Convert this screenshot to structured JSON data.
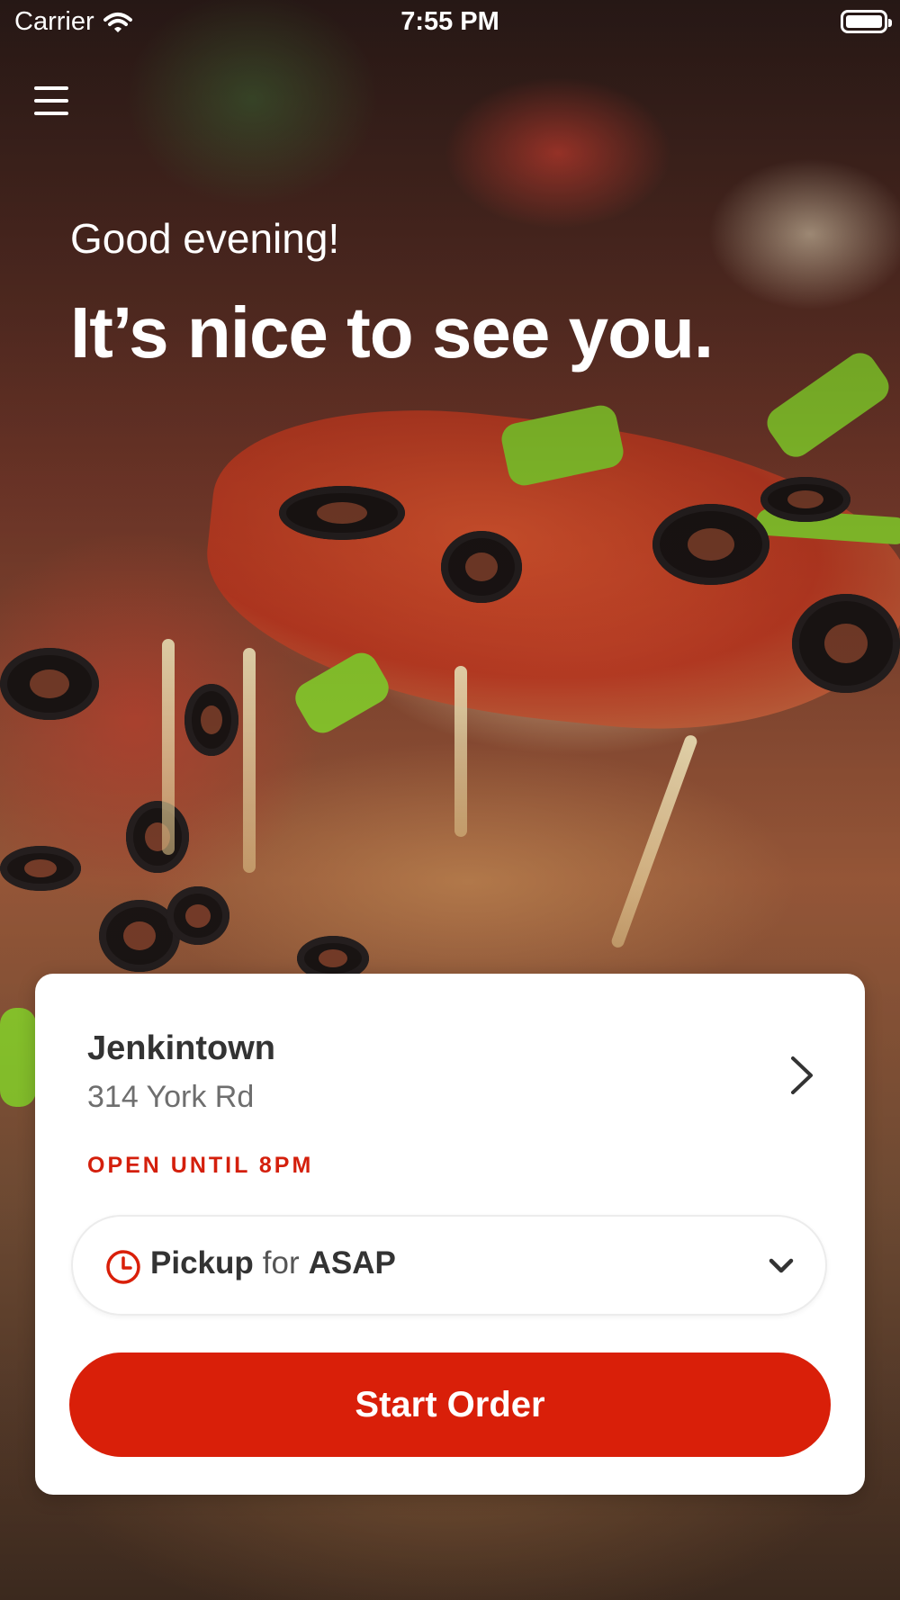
{
  "status_bar": {
    "carrier": "Carrier",
    "time": "7:55 PM"
  },
  "icons": {
    "menu": "hamburger-menu-icon",
    "wifi": "wifi-icon",
    "battery": "battery-icon",
    "store_chevron": "chevron-right-icon",
    "clock": "clock-icon",
    "dropdown": "chevron-down-icon"
  },
  "greeting": {
    "small": "Good evening!",
    "large": "It’s nice to see you."
  },
  "store": {
    "name": "Jenkintown",
    "address": "314 York Rd",
    "hours": "OPEN UNTIL 8PM"
  },
  "order_mode": {
    "method": "Pickup",
    "connector": "for",
    "time": "ASAP"
  },
  "actions": {
    "start_order": "Start Order"
  },
  "colors": {
    "accent": "#D91F09",
    "text_dark": "#333333",
    "text_muted": "#6E6E6E"
  }
}
